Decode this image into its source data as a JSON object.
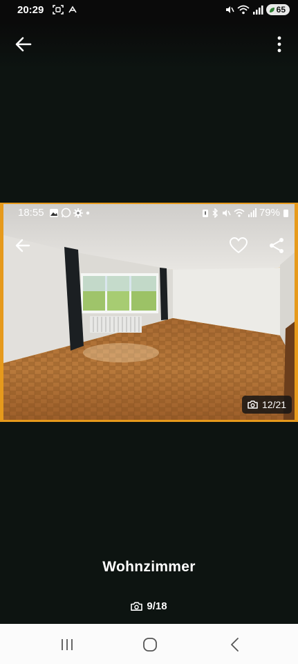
{
  "status_bar": {
    "time": "20:29",
    "battery": "65"
  },
  "photo": {
    "inner_status": {
      "time": "18:55",
      "battery": "79%"
    },
    "counter": "12/21"
  },
  "caption": "Wohnzimmer",
  "gallery_counter": "9/18",
  "icons": {
    "back": "arrow-left-icon",
    "more": "more-vertical-icon",
    "heart": "heart-icon",
    "share": "share-icon",
    "camera": "camera-icon",
    "nav_recents": "recents-icon",
    "nav_home": "home-icon",
    "nav_back": "chevron-left-icon"
  },
  "colors": {
    "background": "#0d1411",
    "photo_border": "#e69a1c",
    "nav_bar": "#fbfbfb"
  }
}
